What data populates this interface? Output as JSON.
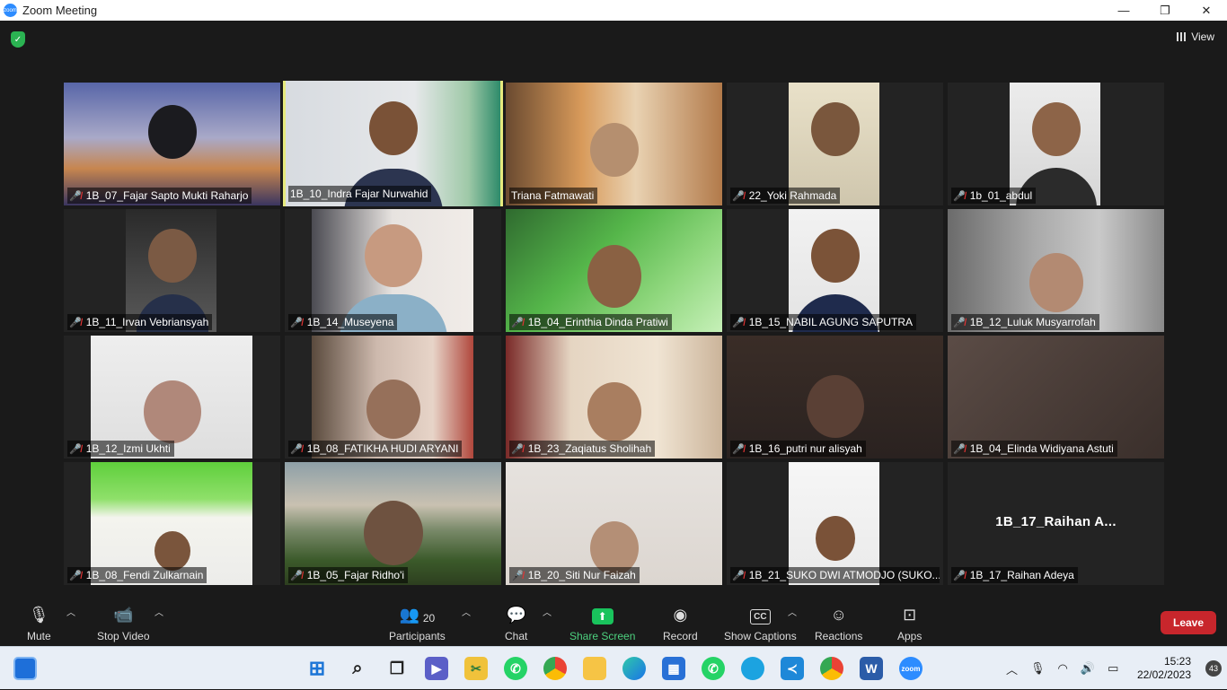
{
  "window": {
    "title": "Zoom Meeting",
    "min": "—",
    "max": "❐",
    "close": "✕"
  },
  "header": {
    "view_label": "View"
  },
  "tiles": [
    {
      "name": "1B_07_Fajar Sapto Mukti Raharjo"
    },
    {
      "name": "1B_10_Indra Fajar Nurwahid"
    },
    {
      "name": "Triana Fatmawati"
    },
    {
      "name": "22_Yoki Rahmada"
    },
    {
      "name": "1b_01_abdul"
    },
    {
      "name": "1B_11_Irvan Vebriansyah"
    },
    {
      "name": "1B_14_Museyena"
    },
    {
      "name": "1B_04_Erinthia Dinda Pratiwi"
    },
    {
      "name": "1B_15_NABIL AGUNG SAPUTRA"
    },
    {
      "name": "1B_12_Luluk Musyarrofah"
    },
    {
      "name": "1B_12_Izmi Ukhti"
    },
    {
      "name": "1B_08_FATIKHA HUDI ARYANI"
    },
    {
      "name": "1B_23_Zaqiatus Sholihah"
    },
    {
      "name": "1B_16_putri nur alisyah"
    },
    {
      "name": "1B_04_Elinda Widiyana Astuti"
    },
    {
      "name": "1B_08_Fendi Zulkarnain"
    },
    {
      "name": "1B_05_Fajar Ridho'i"
    },
    {
      "name": "1B_20_Siti Nur Faizah"
    },
    {
      "name": "1B_21_SUKO DWI ATMODJO (SUKO..."
    },
    {
      "name": "1B_17_Raihan Adeya",
      "big_name": "1B_17_Raihan  A..."
    }
  ],
  "toolbar": {
    "mute": "Mute",
    "stop_video": "Stop Video",
    "participants": "Participants",
    "participants_count": "20",
    "chat": "Chat",
    "share_screen": "Share Screen",
    "record": "Record",
    "show_captions": "Show Captions",
    "captions_icon": "CC",
    "reactions": "Reactions",
    "apps": "Apps",
    "leave": "Leave"
  },
  "taskbar": {
    "time": "15:23",
    "date": "22/02/2023",
    "notifications": "43"
  },
  "colors": {
    "active_speaker": "#e6ea7d",
    "leave": "#c8262c",
    "share": "#19c35c",
    "muted": "#e43434"
  }
}
